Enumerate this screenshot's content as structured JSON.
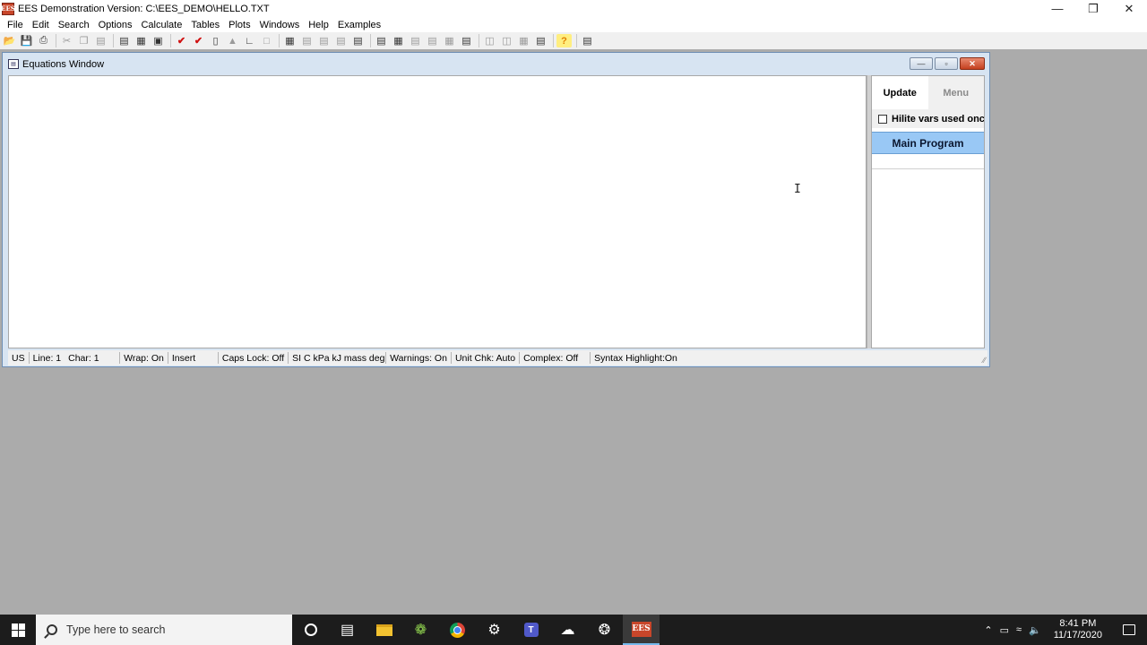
{
  "app": {
    "title": "EES Demonstration Version:  C:\\EES_DEMO\\HELLO.TXT",
    "icon_text": "EES",
    "window_controls": {
      "minimize": "—",
      "restore": "❐",
      "close": "✕"
    }
  },
  "menu": [
    "File",
    "Edit",
    "Search",
    "Options",
    "Calculate",
    "Tables",
    "Plots",
    "Windows",
    "Help",
    "Examples"
  ],
  "equations_window": {
    "title": "Equations Window",
    "controls": {
      "minimize": "—",
      "restore": "▫",
      "close": "✕"
    },
    "side_panel": {
      "tab_update": "Update",
      "tab_menu": "Menu",
      "hilite_label": "Hilite vars used once",
      "main_program": "Main Program"
    },
    "cursor_glyph": "I",
    "status": {
      "units": "US",
      "line": "Line: 1",
      "char": "Char: 1",
      "wrap": "Wrap: On",
      "mode": "Insert",
      "caps": "Caps Lock: Off",
      "unit_system": "SI C kPa kJ mass deg",
      "warnings": "Warnings: On",
      "unit_check": "Unit Chk: Auto",
      "complex": "Complex: Off",
      "syntax": "Syntax Highlight:On"
    }
  },
  "taskbar": {
    "search_placeholder": "Type here to search",
    "time": "8:41 PM",
    "date": "11/17/2020"
  }
}
